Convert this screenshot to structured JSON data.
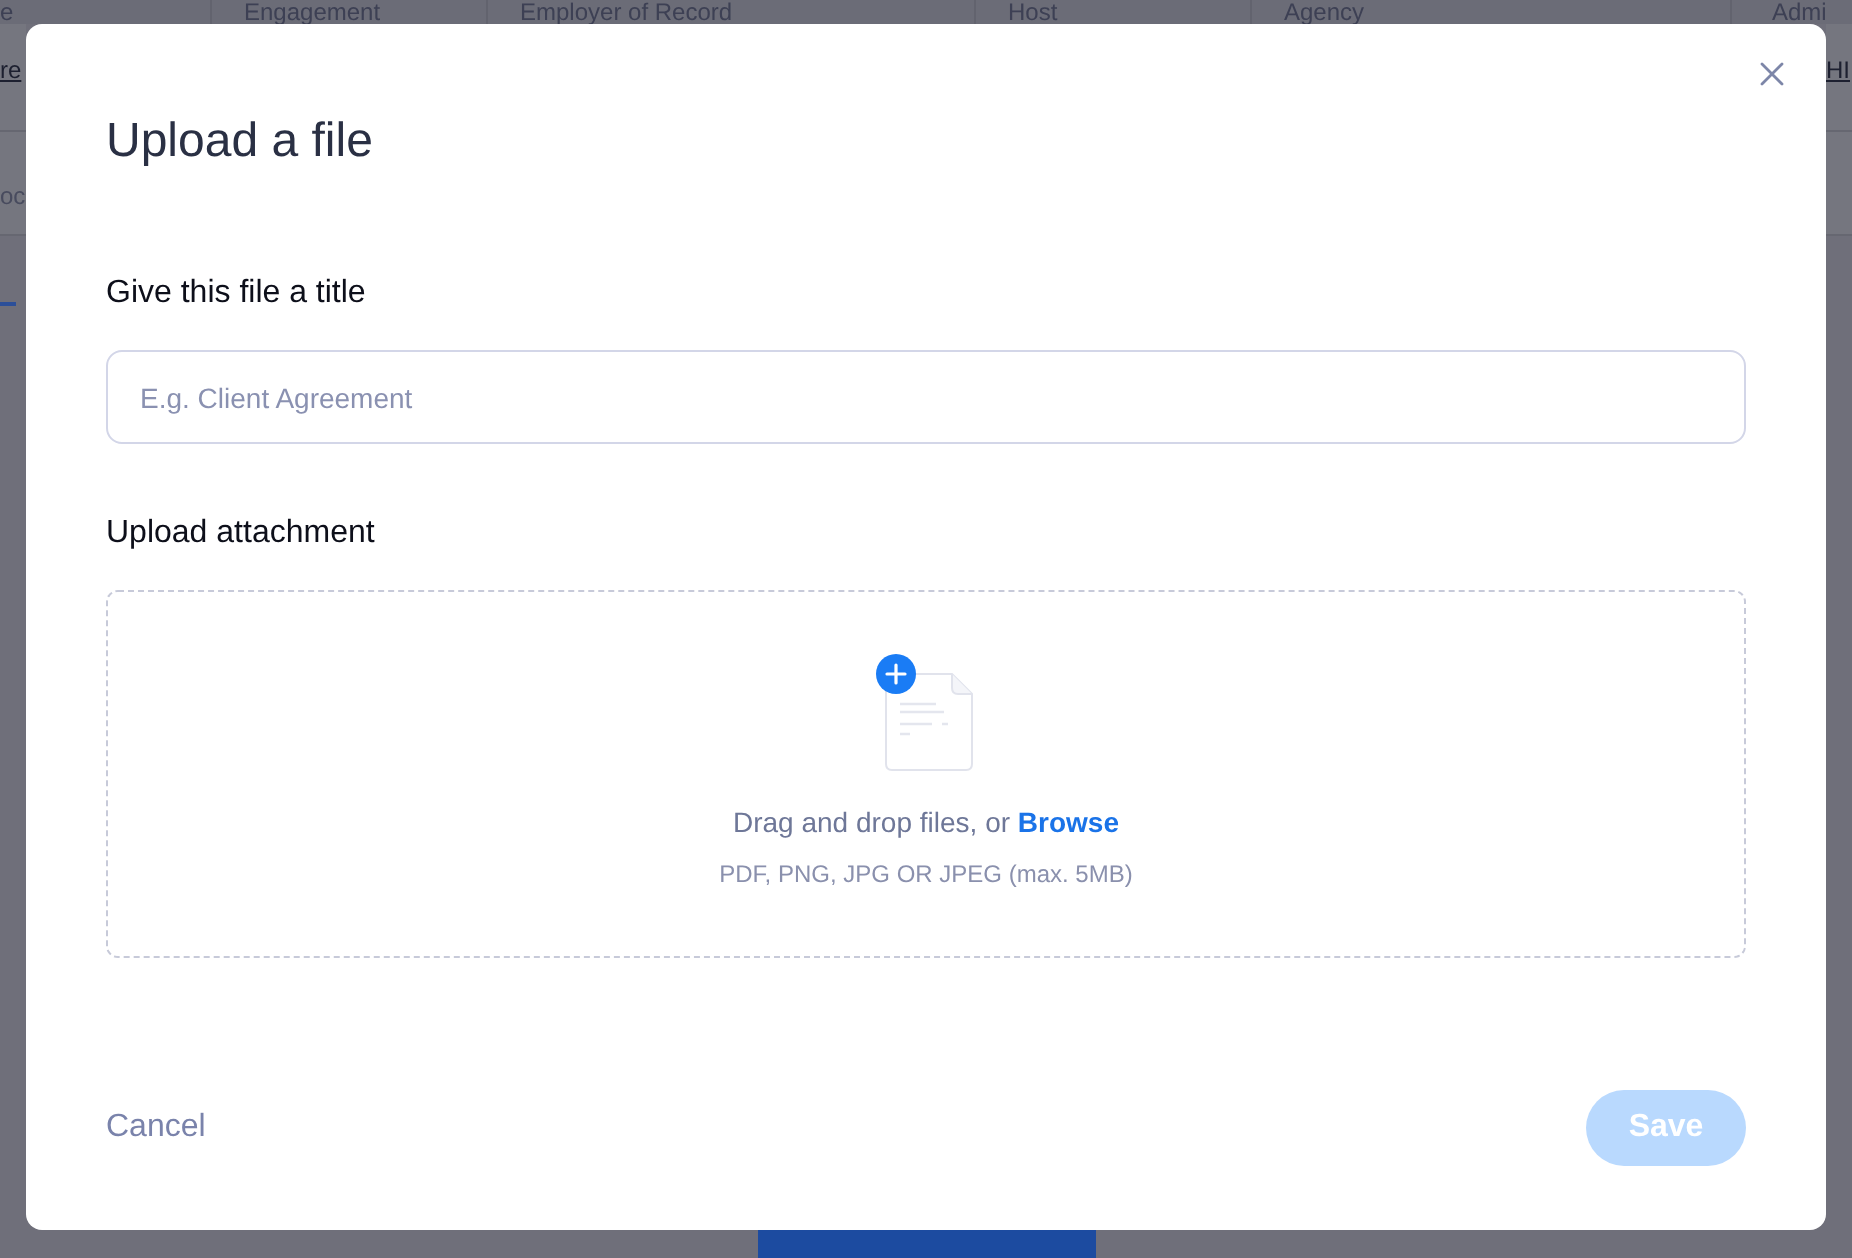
{
  "background": {
    "table_headers": [
      "e",
      "Engagement",
      "Employer of Record",
      "Host",
      "Agency",
      "Admi"
    ],
    "row_links": [
      "re",
      "HI"
    ],
    "row_text": "oc"
  },
  "modal": {
    "title": "Upload a file",
    "title_field": {
      "label": "Give this file a title",
      "placeholder": "E.g. Client Agreement"
    },
    "attachment": {
      "label": "Upload attachment",
      "prompt": "Drag and drop files, or",
      "browse": "Browse",
      "hint": "PDF, PNG, JPG OR JPEG (max. 5MB)"
    },
    "buttons": [
      {
        "label": "Cancel",
        "kind": "link",
        "disabled": false
      },
      {
        "label": "Save",
        "kind": "primary",
        "disabled": true
      }
    ]
  }
}
